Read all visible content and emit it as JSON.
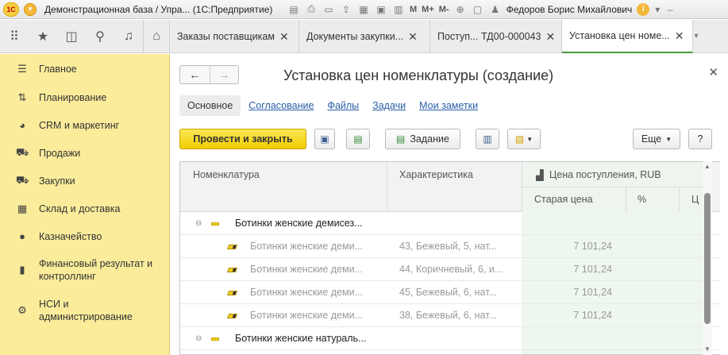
{
  "titlebar": {
    "logo": "1С",
    "title": "Демонстрационная база / Упра... (1С:Предприятие)",
    "m_label": "M",
    "mplus_label": "M+",
    "mminus_label": "M-",
    "user": "Федоров Борис Михайлович"
  },
  "tabs": [
    {
      "label": "Заказы поставщикам"
    },
    {
      "label": "Документы закупки..."
    },
    {
      "label": "Поступ... ТД00-000043"
    },
    {
      "label": "Установка цен номе..."
    }
  ],
  "sidebar": {
    "items": [
      {
        "label": "Главное",
        "icon": "menu-icon"
      },
      {
        "label": "Планирование",
        "icon": "planning-icon"
      },
      {
        "label": "CRM и маркетинг",
        "icon": "crm-icon"
      },
      {
        "label": "Продажи",
        "icon": "cart-icon"
      },
      {
        "label": "Закупки",
        "icon": "truck-icon"
      },
      {
        "label": "Склад и доставка",
        "icon": "warehouse-icon"
      },
      {
        "label": "Казначейство",
        "icon": "ruble-icon"
      },
      {
        "label": "Финансовый результат и\nконтроллинг",
        "icon": "chart-icon"
      },
      {
        "label": "НСИ и\nадминистрирование",
        "icon": "gear-icon"
      }
    ]
  },
  "form": {
    "title": "Установка цен номенклатуры (создание)",
    "subtabs": [
      "Основное",
      "Согласование",
      "Файлы",
      "Задачи",
      "Мои заметки"
    ],
    "toolbar": {
      "post_close": "Провести и закрыть",
      "task": "Задание",
      "more": "Еще",
      "help": "?"
    }
  },
  "table": {
    "headers": {
      "nomenclature": "Номенклатура",
      "characteristic": "Характеристика",
      "price_group": "Цена поступления, RUB",
      "old_price": "Старая цена",
      "percent": "%",
      "new_price": "Ц"
    },
    "rows": [
      {
        "type": "group",
        "name": "Ботинки женские демисез...",
        "characteristic": "",
        "price": ""
      },
      {
        "type": "item",
        "name": "Ботинки женские деми...",
        "characteristic": "43, Бежевый, 5, нат...",
        "price": "7 101,24"
      },
      {
        "type": "item",
        "name": "Ботинки женские деми...",
        "characteristic": "44, Коричневый, 6, и...",
        "price": "7 101,24"
      },
      {
        "type": "item",
        "name": "Ботинки женские деми...",
        "characteristic": "45, Бежевый, 6, нат...",
        "price": "7 101,24"
      },
      {
        "type": "item",
        "name": "Ботинки женские деми...",
        "characteristic": "38, Бежевый, 6, нат...",
        "price": "7 101,24"
      },
      {
        "type": "group",
        "name": "Ботинки женские натураль...",
        "characteristic": "",
        "price": ""
      }
    ]
  }
}
